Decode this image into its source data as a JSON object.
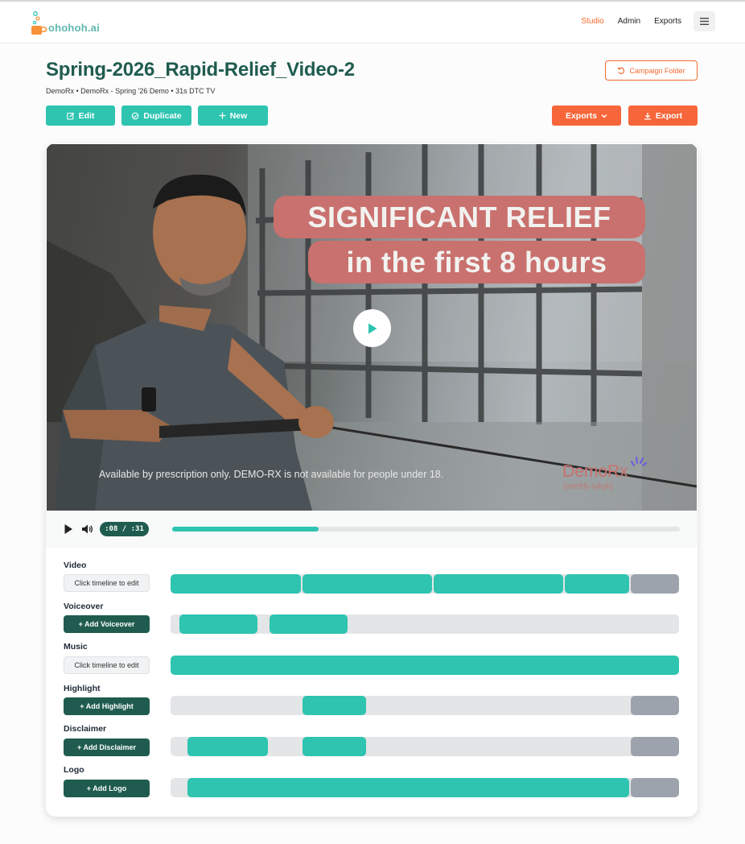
{
  "brand": {
    "name": "ohohoh.ai"
  },
  "nav": {
    "studio": "Studio",
    "admin": "Admin",
    "exports": "Exports"
  },
  "header": {
    "title": "Spring-2026_Rapid-Relief_Video-2",
    "subtitle": "DemoRx • DemoRx - Spring '26 Demo • 31s DTC TV",
    "campaign_folder": "Campaign Folder"
  },
  "actions": {
    "edit": "Edit",
    "duplicate": "Duplicate",
    "new": "New",
    "exports": "Exports",
    "export": "Export"
  },
  "video": {
    "overlay_line1": "SIGNIFICANT RELIEF",
    "overlay_line2": "in the first 8 hours",
    "disclaimer": "Available by prescription only. DEMO-RX is not available for people under 18.",
    "logo_name": "DemoRx",
    "logo_sub": "(relefify-lykyk)"
  },
  "player": {
    "time": ":08 / :31",
    "progress": 0.289
  },
  "tracks": [
    {
      "label": "Video",
      "button": "Click timeline to edit"
    },
    {
      "label": "Voiceover",
      "button": "+ Add Voiceover"
    },
    {
      "label": "Music",
      "button": "Click timeline to edit"
    },
    {
      "label": "Highlight",
      "button": "+ Add Highlight"
    },
    {
      "label": "Disclaimer",
      "button": "+ Add Disclaimer"
    },
    {
      "label": "Logo",
      "button": "+ Add Logo"
    }
  ],
  "colors": {
    "teal": "#2ec4b0",
    "dark_green": "#1f5c4f",
    "orange": "#f7663a",
    "gray_segment": "#9ca3ad"
  }
}
